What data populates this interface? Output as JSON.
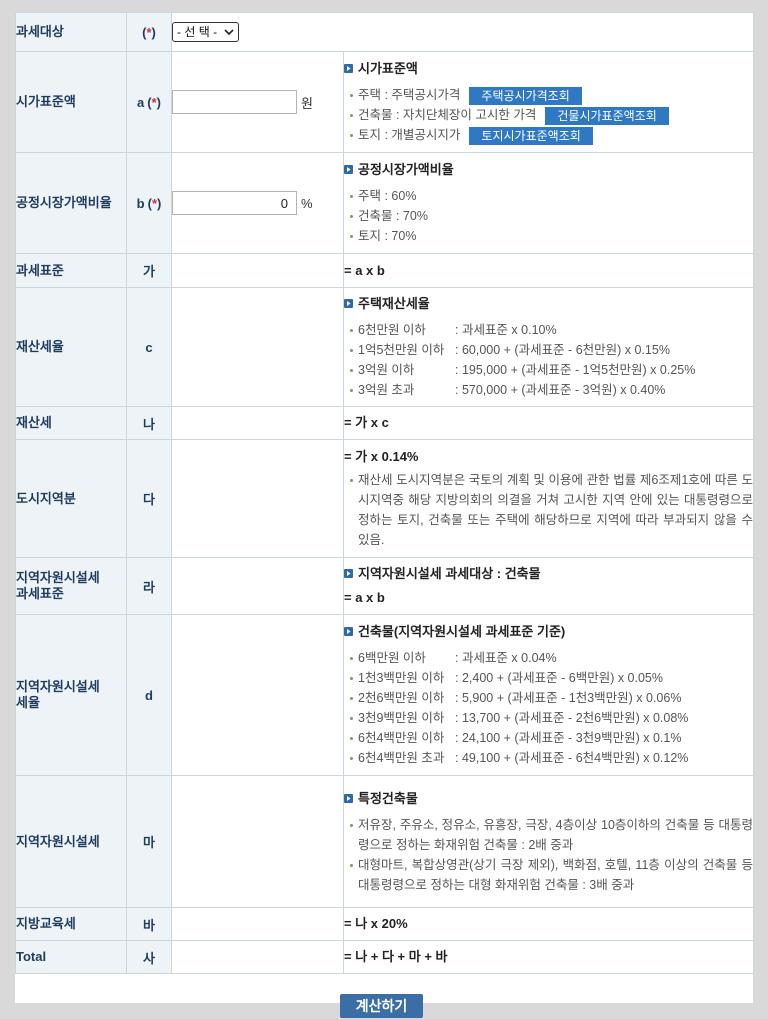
{
  "colors": {
    "page_bg": "#d9d9d9",
    "border": "#c8d7de",
    "label_bg": "#edf3f6",
    "label_text": "#1f3b5f",
    "required": "#d03030",
    "bullet": "#7d9b5e",
    "heading_icon": "#2f6aa6",
    "link_button": "#2f79c4",
    "submit_button": "#3a6ea5"
  },
  "icons": {
    "heading": "blue-square-bullet",
    "select": "chevron-down"
  },
  "required_mark": {
    "open": "(",
    "star": "*",
    "close": ")"
  },
  "tax_target": {
    "label": "과세대상",
    "select_selected": "- 선 택 -"
  },
  "standard_price": {
    "label": "시가표준액",
    "symbol": "a",
    "input_value": "",
    "unit": "원",
    "heading": "시가표준액",
    "items": [
      {
        "text": "주택 : 주택공시가격",
        "button": "주택공시가격조회"
      },
      {
        "text": "건축물 : 자치단체장이 고시한 가격",
        "button": "건물시가표준액조회"
      },
      {
        "text": "토지 : 개별공시지가",
        "button": "토지시가표준액조회"
      }
    ]
  },
  "fair_market_ratio": {
    "label": "공정시장가액비율",
    "symbol": "b",
    "input_value": "0",
    "unit": "%",
    "heading": "공정시장가액비율",
    "items": [
      "주택 : 60%",
      "건축물 : 70%",
      "토지 : 70%"
    ]
  },
  "tax_base": {
    "label": "과세표준",
    "symbol": "가",
    "formula": "= a x b"
  },
  "property_tax_rate": {
    "label": "재산세율",
    "symbol": "c",
    "heading": "주택재산세율",
    "items": [
      {
        "bracket": "6천만원 이하",
        "rate": ": 과세표준 x 0.10%"
      },
      {
        "bracket": "1억5천만원 이하",
        "rate": ": 60,000 + (과세표준 - 6천만원) x 0.15%"
      },
      {
        "bracket": "3억원 이하",
        "rate": ": 195,000 + (과세표준 - 1억5천만원) x 0.25%"
      },
      {
        "bracket": "3억원 초과",
        "rate": ": 570,000 + (과세표준 - 3억원) x 0.40%"
      }
    ]
  },
  "property_tax": {
    "label": "재산세",
    "symbol": "나",
    "formula": "= 가 x c"
  },
  "urban_area": {
    "label": "도시지역분",
    "symbol": "다",
    "formula": "= 가 x 0.14%",
    "note": "재산세 도시지역분은 국토의 계획 및 이용에 관한 법률 제6조제1호에 따른 도시지역중 해당 지방의회의 의결을 거쳐 고시한 지역 안에 있는 대통령령으로 정하는 토지, 건축물 또는 주택에 해당하므로 지역에 따라 부과되지 않을 수 있음."
  },
  "local_resource_base": {
    "label_lines": [
      "지역자원시설세",
      "과세표준"
    ],
    "symbol": "라",
    "heading": "지역자원시설세 과세대상 : 건축물",
    "formula": "= a x b"
  },
  "local_resource_rate": {
    "label_lines": [
      "지역자원시설세",
      "세율"
    ],
    "symbol": "d",
    "heading": "건축물(지역자원시설세 과세표준 기준)",
    "items": [
      {
        "bracket": "6백만원 이하",
        "rate": ": 과세표준 x 0.04%"
      },
      {
        "bracket": "1천3백만원 이하",
        "rate": ": 2,400 + (과세표준 - 6백만원) x 0.05%"
      },
      {
        "bracket": "2천6백만원 이하",
        "rate": ": 5,900 + (과세표준 - 1천3백만원) x 0.06%"
      },
      {
        "bracket": "3천9백만원 이하",
        "rate": ": 13,700 + (과세표준 - 2천6백만원) x 0.08%"
      },
      {
        "bracket": "6천4백만원 이하",
        "rate": ": 24,100 + (과세표준 - 3천9백만원) x 0.1%"
      },
      {
        "bracket": "6천4백만원 초과",
        "rate": ": 49,100 + (과세표준 - 6천4백만원) x 0.12%"
      }
    ]
  },
  "local_resource_tax": {
    "label": "지역자원시설세",
    "symbol": "마",
    "heading": "특정건축물",
    "items": [
      "저유장, 주유소, 정유소, 유흥장, 극장, 4층이상 10층이하의 건축물 등 대통령령으로 정하는 화재위험 건축물 : 2배 중과",
      "대형마트, 복합상영관(상기 극장 제외), 백화점, 호텔, 11층 이상의 건축물 등 대통령령으로 정하는 대형 화재위험 건축물 : 3배 중과"
    ]
  },
  "local_education_tax": {
    "label": "지방교육세",
    "symbol": "바",
    "formula": "= 나 x 20%"
  },
  "total": {
    "label": "Total",
    "symbol": "사",
    "formula": "= 나 + 다 + 마 + 바"
  },
  "submit_button": "계산하기"
}
